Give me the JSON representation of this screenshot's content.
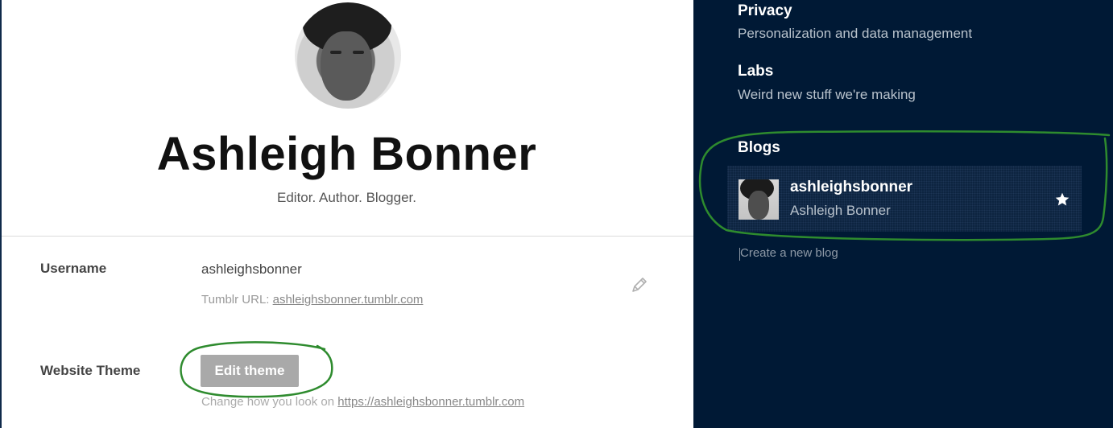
{
  "profile": {
    "name": "Ashleigh Bonner",
    "bio": "Editor. Author. Blogger."
  },
  "account": {
    "username_label": "Username",
    "username_value": "ashleighsbonner",
    "url_prefix": "Tumblr URL: ",
    "url_value": "ashleighsbonner.tumblr.com",
    "theme_label": "Website Theme",
    "edit_theme_label": "Edit theme",
    "theme_help_prefix": "Change how you look on ",
    "theme_help_link": "https://ashleighsbonner.tumblr.com"
  },
  "sidebar": {
    "privacy": {
      "title": "Privacy",
      "subtitle": "Personalization and data management"
    },
    "labs": {
      "title": "Labs",
      "subtitle": "Weird new stuff we're making"
    },
    "blogs_heading": "Blogs",
    "blogs": [
      {
        "name": "ashleighsbonner",
        "title": "Ashleigh Bonner",
        "starred": true
      }
    ],
    "create_blog": "Create a new blog"
  },
  "icons": {
    "edit": "pencil-icon",
    "primary_blog": "star-icon"
  },
  "colors": {
    "sidebar_bg": "#001935",
    "annotation": "#2e8b2e",
    "button_bg": "#a9a9a9"
  }
}
